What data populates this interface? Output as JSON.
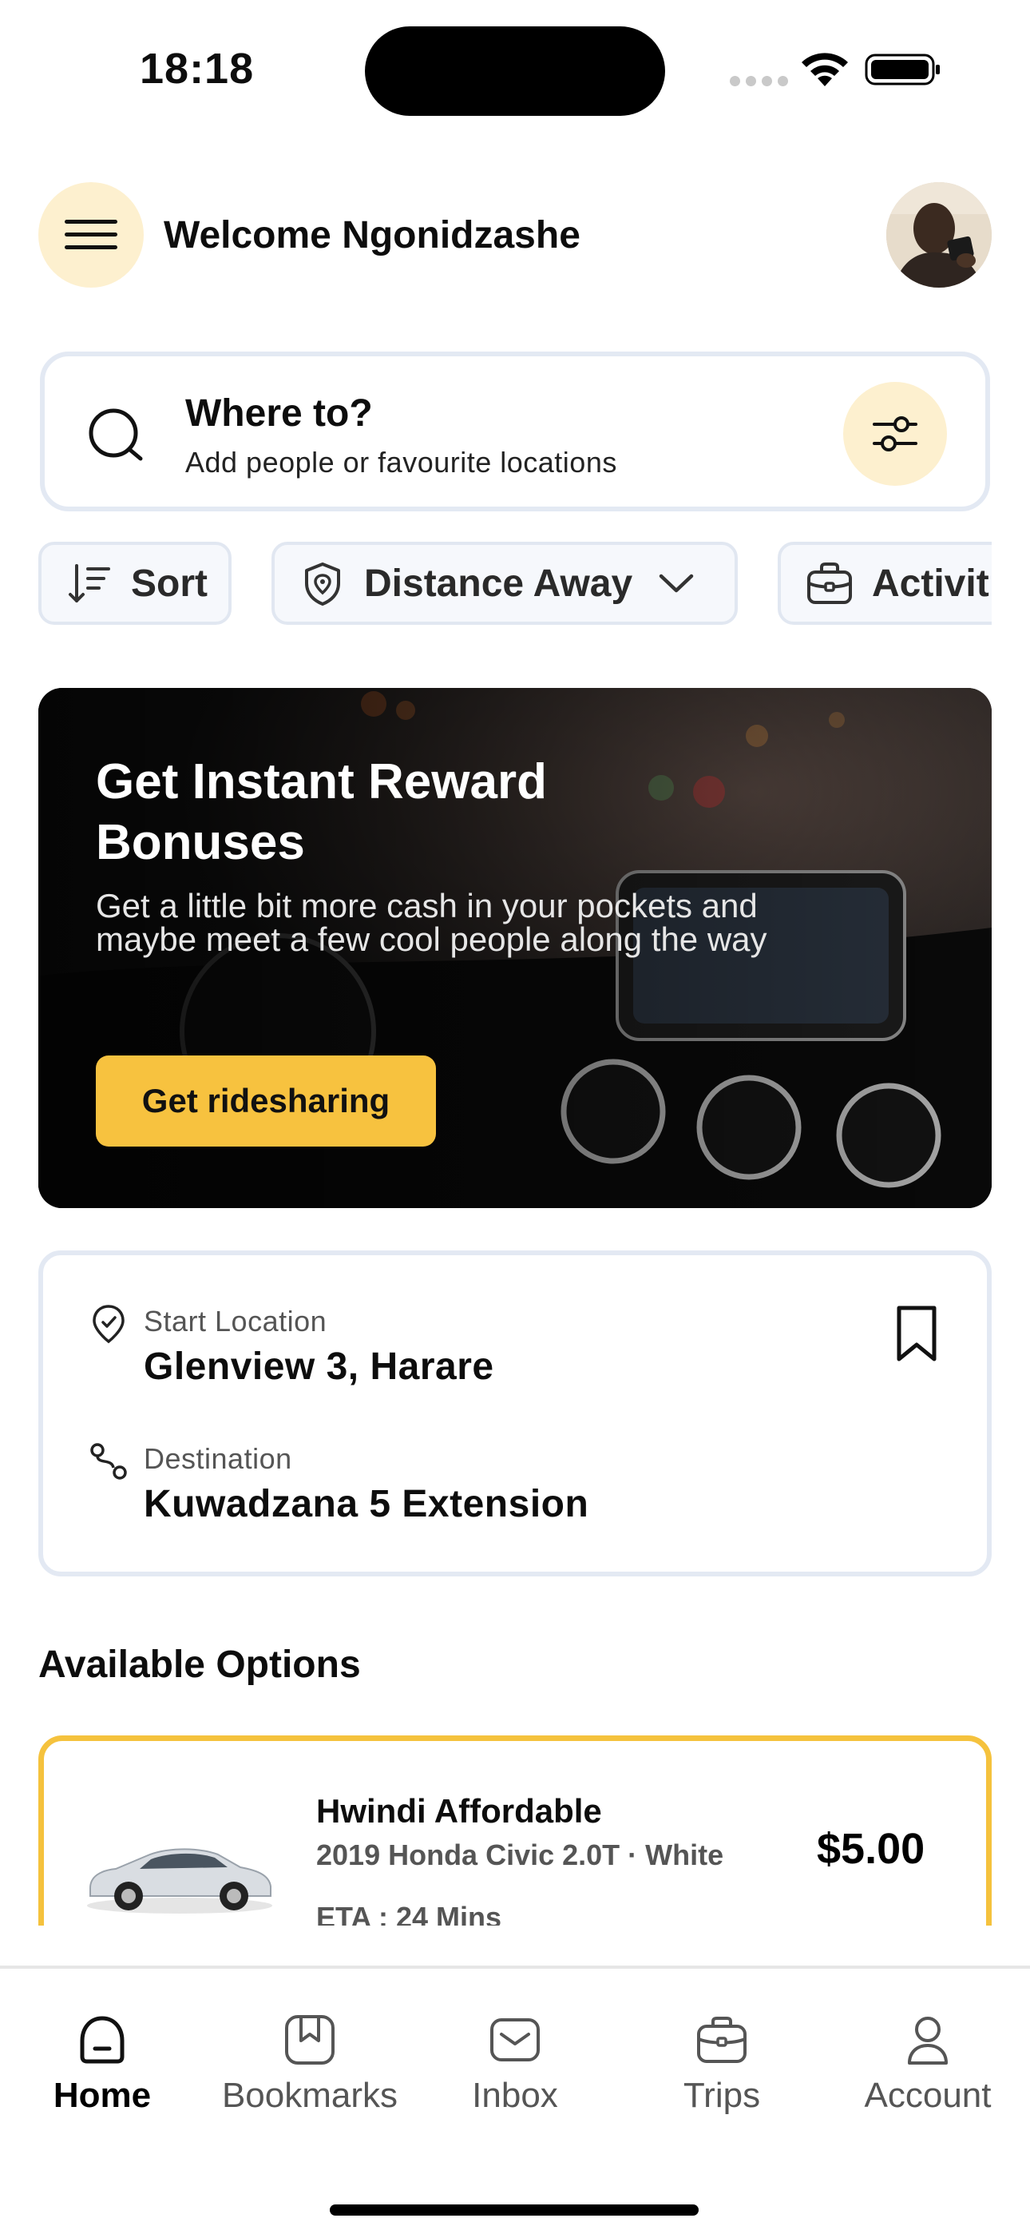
{
  "status_bar": {
    "time": "18:18"
  },
  "header": {
    "welcome": "Welcome Ngonidzashe"
  },
  "search": {
    "title": "Where to?",
    "subtitle": "Add people or favourite locations"
  },
  "chips": [
    {
      "label": "Sort",
      "icon": "sort-icon"
    },
    {
      "label": "Distance Away",
      "icon": "shield-location-icon"
    },
    {
      "label": "Activit",
      "icon": "briefcase-icon"
    }
  ],
  "banner": {
    "title": "Get Instant Reward Bonuses",
    "text": "Get a little bit more cash in your pockets and maybe meet a few cool people along the way",
    "button": "Get ridesharing"
  },
  "locations": {
    "start_label": "Start Location",
    "start_value": "Glenview 3, Harare",
    "dest_label": "Destination",
    "dest_value": "Kuwadzana 5 Extension"
  },
  "section_title": "Available Options",
  "option": {
    "name": "Hwindi Affordable",
    "description": "2019 Honda Civic 2.0T · White",
    "eta": "ETA : 24 Mins",
    "price": "$5.00"
  },
  "tabs": [
    {
      "label": "Home",
      "icon": "home-icon",
      "active": true
    },
    {
      "label": "Bookmarks",
      "icon": "bookmarks-icon"
    },
    {
      "label": "Inbox",
      "icon": "inbox-icon"
    },
    {
      "label": "Trips",
      "icon": "briefcase-icon"
    },
    {
      "label": "Account",
      "icon": "user-icon"
    }
  ],
  "colors": {
    "accent": "#f7c23f",
    "accent_soft": "#fdf0cf",
    "border": "#e3e9f3",
    "text": "#0d0d0d"
  }
}
